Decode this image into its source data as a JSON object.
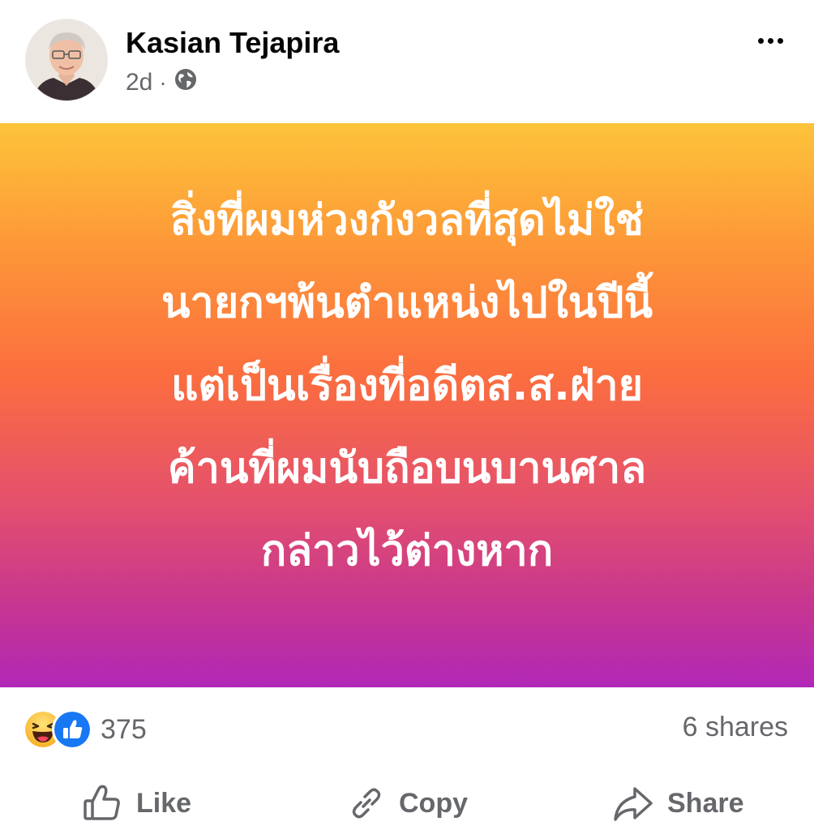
{
  "post": {
    "author": "Kasian Tejapira",
    "time": "2d",
    "separator": "·",
    "audience_icon": "globe-icon",
    "menu_icon": "more-options-icon",
    "text_lines": [
      "สิ่งที่ผมห่วงกังวลที่สุดไม่ใช่",
      "นายกฯพ้นตำแหน่งไปในปีนี้",
      "แต่เป็นเรื่องที่อดีตส.ส.ฝ่าย",
      "ค้านที่ผมนับถือบนบานศาล",
      "กล่าวไว้ต่างหาก"
    ],
    "background_colors": [
      "#fdc43a",
      "#fb6d3f",
      "#b128b7"
    ]
  },
  "stats": {
    "reaction_icons": [
      "haha-icon",
      "like-icon"
    ],
    "reaction_count": "375",
    "shares": "6 shares"
  },
  "actions": {
    "like": "Like",
    "copy": "Copy",
    "share": "Share"
  },
  "colors": {
    "text_primary": "#050505",
    "text_secondary": "#65676b",
    "like_blue": "#1877f2"
  }
}
